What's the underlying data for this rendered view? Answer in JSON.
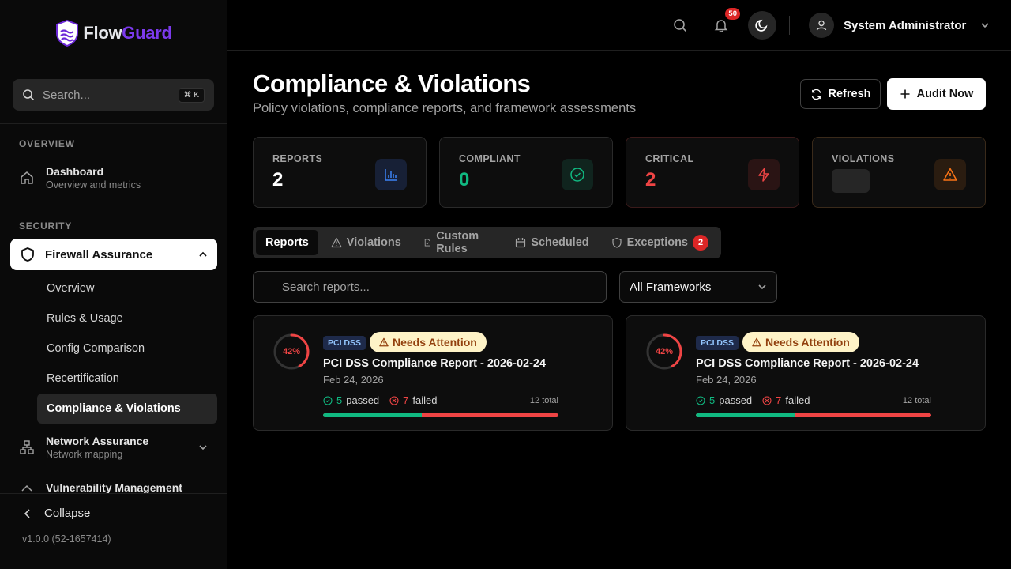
{
  "app": {
    "brand_part1": "Flow",
    "brand_part2": "Guard",
    "search_placeholder": "Search...",
    "search_shortcut": "⌘ K",
    "version": "v1.0.0 (52-1657414)",
    "collapse_label": "Collapse"
  },
  "sidebar": {
    "sections": [
      {
        "title": "OVERVIEW"
      },
      {
        "title": "SECURITY"
      }
    ],
    "dashboard": {
      "label": "Dashboard",
      "sub": "Overview and metrics",
      "icon": "home-icon"
    },
    "firewall": {
      "label": "Firewall Assurance",
      "icon": "shield-icon",
      "expanded": true
    },
    "firewall_items": [
      "Overview",
      "Rules & Usage",
      "Config Comparison",
      "Recertification",
      "Compliance & Violations"
    ],
    "firewall_active_index": 4,
    "network": {
      "label": "Network Assurance",
      "sub": "Network mapping",
      "icon": "network-icon"
    },
    "vuln": {
      "label": "Vulnerability Management"
    }
  },
  "header": {
    "notifications_count": "50",
    "user_name": "System Administrator"
  },
  "page": {
    "title": "Compliance & Violations",
    "subtitle": "Policy violations, compliance reports, and framework assessments",
    "refresh_label": "Refresh",
    "audit_label": "Audit Now"
  },
  "stats": [
    {
      "label": "REPORTS",
      "value": "2",
      "color": "#ffffff",
      "icon": "bar-chart-icon"
    },
    {
      "label": "COMPLIANT",
      "value": "0",
      "color": "#10b981",
      "icon": "check-circle-icon"
    },
    {
      "label": "CRITICAL",
      "value": "2",
      "color": "#ef4444",
      "icon": "zap-icon"
    },
    {
      "label": "VIOLATIONS",
      "value": null,
      "loading": true,
      "icon": "warning-icon"
    }
  ],
  "tabs": [
    {
      "label": "Reports",
      "active": true
    },
    {
      "label": "Violations"
    },
    {
      "label": "Custom Rules"
    },
    {
      "label": "Scheduled"
    },
    {
      "label": "Exceptions",
      "badge": "2"
    }
  ],
  "filters": {
    "search_placeholder": "Search reports...",
    "framework_selected": "All Frameworks"
  },
  "reports": [
    {
      "score": "42%",
      "score_fraction": 0.42,
      "framework": "PCI DSS",
      "status": "Needs Attention",
      "title": "PCI DSS Compliance Report - 2026-02-24",
      "date": "Feb 24, 2026",
      "passed": "5",
      "passed_label": "passed",
      "failed": "7",
      "failed_label": "failed",
      "total": "12 total",
      "pass_fraction": 0.42
    },
    {
      "score": "42%",
      "score_fraction": 0.42,
      "framework": "PCI DSS",
      "status": "Needs Attention",
      "title": "PCI DSS Compliance Report - 2026-02-24",
      "date": "Feb 24, 2026",
      "passed": "5",
      "passed_label": "passed",
      "failed": "7",
      "failed_label": "failed",
      "total": "12 total",
      "pass_fraction": 0.42
    }
  ],
  "colors": {
    "accent": "#7c3aed",
    "pass": "#10b981",
    "fail": "#ef4444",
    "warning_bg": "#fef3c7"
  }
}
